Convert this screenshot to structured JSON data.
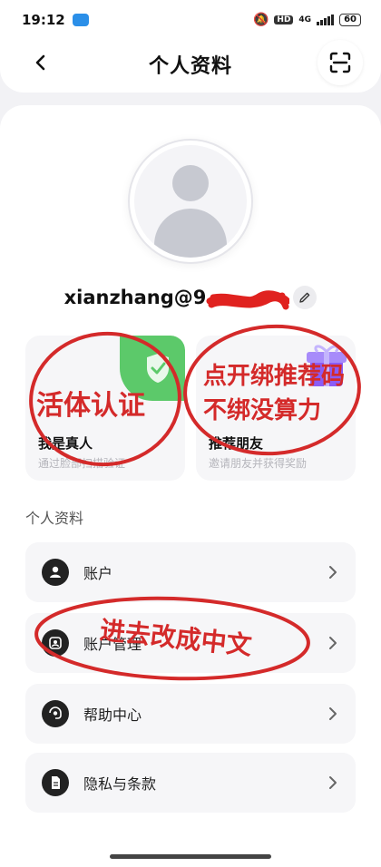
{
  "status_bar": {
    "time": "19:12",
    "hd": "HD",
    "network": "4G",
    "battery": "60"
  },
  "header": {
    "title": "个人资料"
  },
  "profile": {
    "username": "xianzhang@9"
  },
  "features": [
    {
      "title": "我是真人",
      "subtitle": "通过脸部扫描验证",
      "icon": "verified-shield-icon",
      "color": "#5cc96a"
    },
    {
      "title": "推荐朋友",
      "subtitle": "邀请朋友并获得奖励",
      "icon": "gift-box-icon",
      "color": "#8b5cf6"
    }
  ],
  "section": {
    "title": "个人资料"
  },
  "menu": [
    {
      "label": "账户",
      "icon": "user-circle-icon"
    },
    {
      "label": "账户管理",
      "icon": "account-manage-icon"
    },
    {
      "label": "帮助中心",
      "icon": "help-chat-icon"
    },
    {
      "label": "隐私与条款",
      "icon": "document-icon"
    }
  ],
  "annotations": {
    "note1": "活体认证",
    "note2_line1": "点开绑推荐码",
    "note2_line2": "不绑没算力",
    "note3": "进去改成中文"
  },
  "colors": {
    "annotation_red": "#d42a2a",
    "verify_green": "#5cc96a",
    "gift_purple": "#8b5cf6"
  }
}
